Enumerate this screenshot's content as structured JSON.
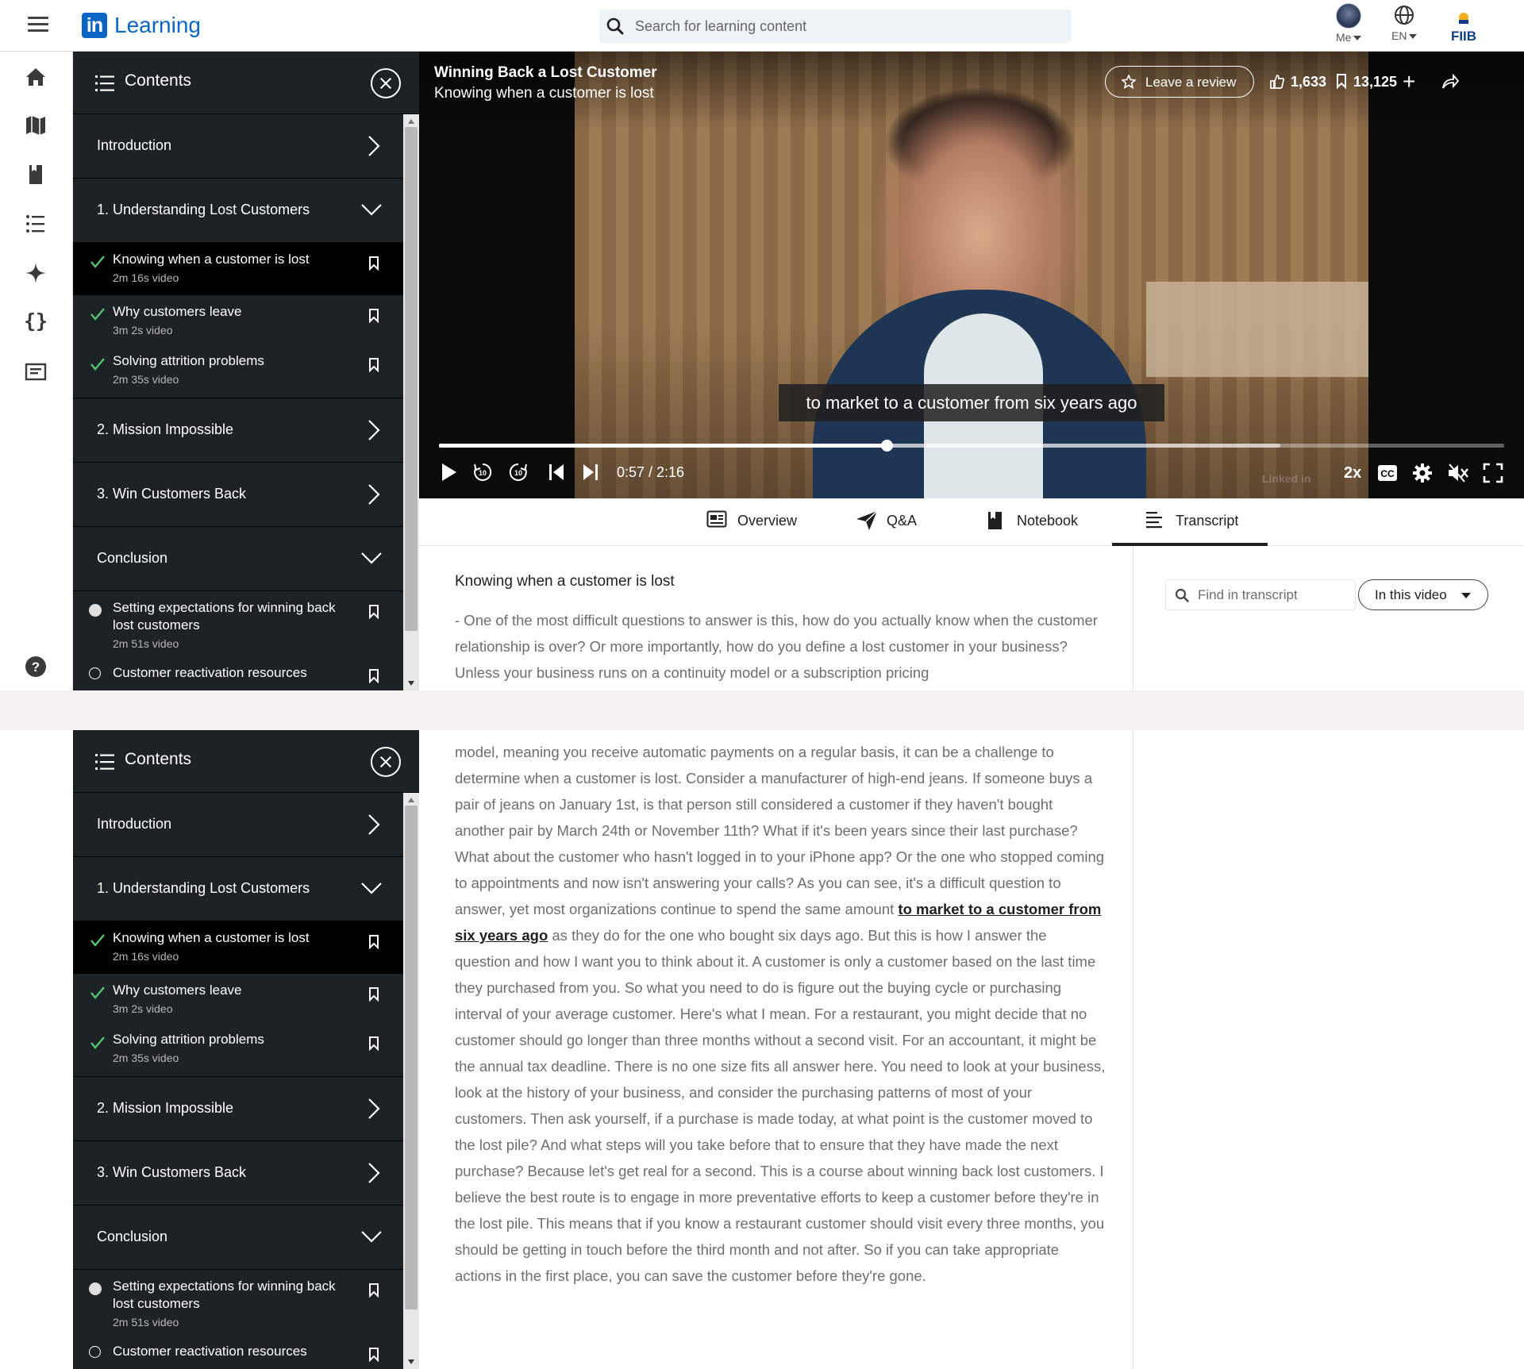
{
  "app": {
    "logo_text": "Learning",
    "logo_in": "in"
  },
  "search": {
    "placeholder": "Search for learning content"
  },
  "topnav": {
    "me_label": "Me",
    "lang_label": "EN",
    "org_logo": "FIIB"
  },
  "rail": {
    "icons": [
      "home-icon",
      "map-icon",
      "bookmark-book-icon",
      "list-icon",
      "sparkle-icon",
      "code-braces-icon",
      "certificate-icon",
      "help-icon"
    ]
  },
  "contents": {
    "title": "Contents",
    "chapters": [
      {
        "label": "Introduction",
        "state": "collapsed"
      },
      {
        "label": "1. Understanding Lost Customers",
        "state": "expanded"
      },
      {
        "label": "2. Mission Impossible",
        "state": "collapsed"
      },
      {
        "label": "3. Win Customers Back",
        "state": "collapsed"
      },
      {
        "label": "Conclusion",
        "state": "expanded"
      }
    ],
    "lessons_ch1": [
      {
        "title": "Knowing when a customer is lost",
        "meta": "2m 16s video",
        "status": "done",
        "active": true
      },
      {
        "title": "Why customers leave",
        "meta": "3m 2s video",
        "status": "done",
        "active": false
      },
      {
        "title": "Solving attrition problems",
        "meta": "2m 35s video",
        "status": "done",
        "active": false
      }
    ],
    "lessons_conclusion": [
      {
        "title": "Setting expectations for winning back lost customers",
        "meta": "2m 51s video",
        "status": "in-progress"
      },
      {
        "title": "Customer reactivation resources",
        "meta": "",
        "status": "not-started"
      }
    ]
  },
  "video": {
    "course_title": "Winning Back a Lost Customer",
    "lesson_title": "Knowing when a customer is lost",
    "review_label": "Leave a review",
    "likes": "1,633",
    "saves": "13,125",
    "caption": "to market to a customer from six years ago",
    "time": "0:57 / 2:16",
    "progress_fraction": 0.42,
    "buffered_fraction": 0.79,
    "speed": "2x",
    "watermark": "Linked in"
  },
  "tabs": [
    {
      "label": "Overview",
      "icon": "overview-icon"
    },
    {
      "label": "Q&A",
      "icon": "send-icon"
    },
    {
      "label": "Notebook",
      "icon": "notebook-icon"
    },
    {
      "label": "Transcript",
      "icon": "transcript-icon",
      "selected": true
    }
  ],
  "transcript": {
    "heading": "Knowing when a customer is lost",
    "find_placeholder": "Find in transcript",
    "scope_label": "In this video",
    "part1": "- One of the most difficult questions to answer is this, how do you actually know when the customer relationship is over? Or more importantly, how do you define a lost customer in your business? Unless your business runs on a continuity model or a subscription pricing",
    "part2_before": "model, meaning you receive automatic payments on a regular basis, it can be a challenge to determine when a customer is lost. Consider a manufacturer of high-end jeans. If someone buys a pair of jeans on January 1st, is that person still considered a customer if they haven't bought another pair by March 24th or November 11th? What if it's been years since their last purchase? What about the customer who hasn't logged in to your iPhone app? Or the one who stopped coming to appointments and now isn't answering your calls? As you can see, it's a difficult question to answer, yet most organizations continue to spend the same amount ",
    "part2_highlight": "to market to a customer from six years ago",
    "part2_after": " as they do for the one who bought six days ago. But this is how I answer the question and how I want you to think about it. A customer is only a customer based on the last time they purchased from you. So what you need to do is figure out the buying cycle or purchasing interval of your average customer. Here's what I mean. For a restaurant, you might decide that no customer should go longer than three months without a second visit. For an accountant, it might be the annual tax deadline. There is no one size fits all answer here. You need to look at your business, look at the history of your business, and consider the purchasing patterns of most of your customers. Then ask yourself, if a purchase is made today, at what point is the customer moved to the lost pile? And what steps will you take before that to ensure that they have made the next purchase? Because let's get real for a second. This is a course about winning back lost customers. I believe the best route is to engage in more preventative efforts to keep a customer before they're in the lost pile. This means that if you know a restaurant customer should visit every three months, you should be getting in touch before the third month and not after. So if you can take appropriate actions in the first place, you can save the customer before they're gone."
  }
}
